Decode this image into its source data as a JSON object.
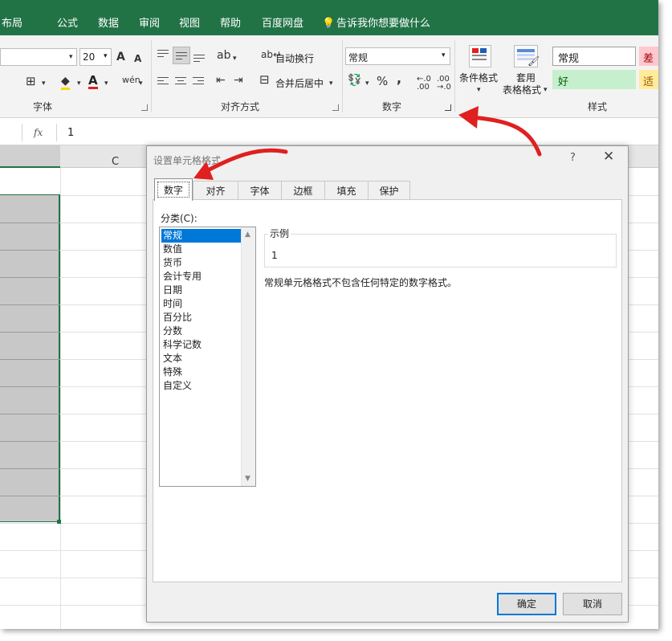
{
  "menu": {
    "items": [
      "布局",
      "公式",
      "数据",
      "审阅",
      "视图",
      "帮助",
      "百度网盘"
    ],
    "tell_me": "告诉我你想要做什么"
  },
  "ribbon": {
    "font": {
      "size": "20",
      "grow": "A",
      "shrink": "A",
      "group_label": "字体"
    },
    "align": {
      "wrap_text": "自动换行",
      "merge_center": "合并后居中",
      "group_label": "对齐方式"
    },
    "number": {
      "format": "常规",
      "percent": "%",
      "comma": ",",
      "inc_dec": "←.0 .00",
      "dec_dec": ".00 →.0",
      "group_label": "数字"
    },
    "styles": {
      "cond_format": "条件格式",
      "table_format_1": "套用",
      "table_format_2": "表格格式",
      "style_normal": "常规",
      "style_bad": "差",
      "style_good": "好",
      "style_neutral": "适",
      "group_label": "样式"
    }
  },
  "formula_bar": {
    "fx": "fx",
    "value": "1"
  },
  "grid": {
    "col_c": "C"
  },
  "dialog": {
    "title": "设置单元格格式",
    "help": "?",
    "close": "✕",
    "tabs": [
      "数字",
      "对齐",
      "字体",
      "边框",
      "填充",
      "保护"
    ],
    "category_label": "分类(C):",
    "categories": [
      "常规",
      "数值",
      "货币",
      "会计专用",
      "日期",
      "时间",
      "百分比",
      "分数",
      "科学记数",
      "文本",
      "特殊",
      "自定义"
    ],
    "sample_label": "示例",
    "sample_value": "1",
    "description": "常规单元格格式不包含任何特定的数字格式。",
    "ok": "确定",
    "cancel": "取消"
  },
  "colors": {
    "excel_green": "#217346",
    "select_blue": "#0078d7",
    "annotation_red": "#e02020"
  }
}
